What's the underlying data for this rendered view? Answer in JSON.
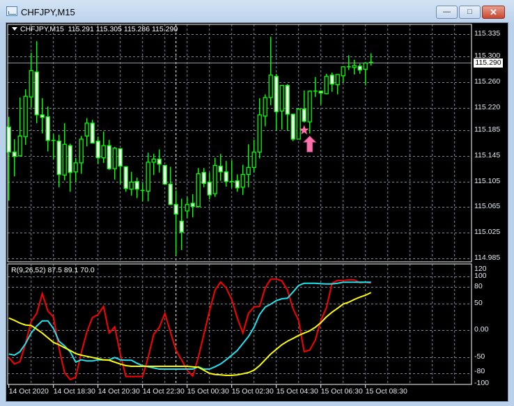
{
  "window": {
    "title": "CHFJPY,M15",
    "buttons": {
      "minimize": "—",
      "maximize": "□",
      "close": "✕"
    }
  },
  "chart_header": {
    "symbol": "CHFJPY,M15",
    "open": "115.291",
    "high": "115.305",
    "low": "115.286",
    "close": "115.290"
  },
  "current_price": "115.290",
  "colors": {
    "background": "#000000",
    "candle": "#00ff00",
    "bear_body": "#ffffff",
    "grid": "#7b8595",
    "red_line": "#ff0000",
    "cyan_line": "#22e4f0",
    "yellow_line": "#ffff00",
    "marker": "#ff6fa8"
  },
  "indicator": {
    "label": "R(9,26,52) 87.5 89.1 70.0"
  },
  "chart_data": [
    {
      "type": "candlestick",
      "title": "CHFJPY,M15",
      "ylim": [
        114.985,
        115.345
      ],
      "y_ticks": [
        "115.335",
        "115.300",
        "115.260",
        "115.220",
        "115.185",
        "115.145",
        "115.105",
        "115.065",
        "115.025",
        "114.985"
      ],
      "x_ticks": [
        "14 Oct 2020",
        "14 Oct 18:30",
        "14 Oct 20:30",
        "14 Oct 22:30",
        "15 Oct 00:30",
        "15 Oct 02:30",
        "15 Oct 04:30",
        "15 Oct 06:30",
        "15 Oct 08:30"
      ],
      "x_tick_every": 8,
      "day_separator_index": 30,
      "ohlc": [
        [
          115.19,
          115.206,
          115.075,
          115.151
        ],
        [
          115.151,
          115.171,
          115.113,
          115.144
        ],
        [
          115.145,
          115.236,
          115.144,
          115.176
        ],
        [
          115.175,
          115.249,
          115.162,
          115.238
        ],
        [
          115.237,
          115.306,
          115.22,
          115.278
        ],
        [
          115.276,
          115.324,
          115.196,
          115.209
        ],
        [
          115.209,
          115.235,
          115.18,
          115.205
        ],
        [
          115.206,
          115.222,
          115.152,
          115.169
        ],
        [
          115.169,
          115.179,
          115.14,
          115.169
        ],
        [
          115.168,
          115.178,
          115.096,
          115.116
        ],
        [
          115.115,
          115.196,
          115.107,
          115.163
        ],
        [
          115.161,
          115.164,
          115.089,
          115.119
        ],
        [
          115.12,
          115.142,
          115.104,
          115.134
        ],
        [
          115.134,
          115.176,
          115.117,
          115.171
        ],
        [
          115.176,
          115.204,
          115.16,
          115.196
        ],
        [
          115.196,
          115.201,
          115.164,
          115.165
        ],
        [
          115.168,
          115.175,
          115.132,
          115.142
        ],
        [
          115.142,
          115.183,
          115.134,
          115.161
        ],
        [
          115.161,
          115.17,
          115.123,
          115.125
        ],
        [
          115.125,
          115.159,
          115.108,
          115.157
        ],
        [
          115.156,
          115.157,
          115.101,
          115.129
        ],
        [
          115.128,
          115.129,
          115.089,
          115.094
        ],
        [
          115.093,
          115.12,
          115.083,
          115.104
        ],
        [
          115.105,
          115.111,
          115.079,
          115.093
        ],
        [
          115.091,
          115.103,
          115.074,
          115.091
        ],
        [
          115.09,
          115.15,
          115.074,
          115.135
        ],
        [
          115.135,
          115.148,
          115.115,
          115.14
        ],
        [
          115.14,
          115.155,
          115.119,
          115.132
        ],
        [
          115.13,
          115.13,
          115.101,
          115.101
        ],
        [
          115.101,
          115.128,
          115.068,
          115.069
        ],
        [
          115.069,
          115.091,
          114.99,
          115.054
        ],
        [
          115.043,
          115.078,
          114.998,
          115.026
        ],
        [
          115.059,
          115.081,
          115.048,
          115.069
        ],
        [
          115.071,
          115.085,
          115.049,
          115.066
        ],
        [
          115.066,
          115.126,
          115.064,
          115.117
        ],
        [
          115.119,
          115.126,
          115.096,
          115.102
        ],
        [
          115.104,
          115.119,
          115.077,
          115.084
        ],
        [
          115.086,
          115.142,
          115.081,
          115.13
        ],
        [
          115.129,
          115.148,
          115.106,
          115.12
        ],
        [
          115.12,
          115.137,
          115.097,
          115.105
        ],
        [
          115.105,
          115.138,
          115.095,
          115.105
        ],
        [
          115.106,
          115.116,
          115.089,
          115.095
        ],
        [
          115.096,
          115.131,
          115.084,
          115.116
        ],
        [
          115.116,
          115.163,
          115.096,
          115.127
        ],
        [
          115.127,
          115.17,
          115.119,
          115.151
        ],
        [
          115.151,
          115.235,
          115.141,
          115.209
        ],
        [
          115.207,
          115.241,
          115.191,
          115.236
        ],
        [
          115.236,
          115.331,
          115.224,
          115.271
        ],
        [
          115.269,
          115.273,
          115.184,
          115.214
        ],
        [
          115.215,
          115.255,
          115.186,
          115.255
        ],
        [
          115.255,
          115.257,
          115.184,
          115.21
        ],
        [
          115.21,
          115.21,
          115.168,
          115.171
        ],
        [
          115.171,
          115.22,
          115.171,
          115.218
        ],
        [
          115.218,
          115.247,
          115.197,
          115.199
        ],
        [
          115.198,
          115.247,
          115.18,
          115.246
        ],
        [
          115.246,
          115.268,
          115.237,
          115.246
        ],
        [
          115.246,
          115.247,
          115.225,
          115.243
        ],
        [
          115.242,
          115.273,
          115.241,
          115.269
        ],
        [
          115.271,
          115.275,
          115.245,
          115.257
        ],
        [
          115.256,
          115.272,
          115.241,
          115.272
        ],
        [
          115.27,
          115.285,
          115.26,
          115.284
        ],
        [
          115.284,
          115.302,
          115.279,
          115.284
        ],
        [
          115.283,
          115.295,
          115.272,
          115.286
        ],
        [
          115.285,
          115.289,
          115.273,
          115.279
        ],
        [
          115.28,
          115.291,
          115.255,
          115.29
        ],
        [
          115.291,
          115.305,
          115.286,
          115.29
        ]
      ],
      "markers": [
        {
          "type": "star",
          "index": 53,
          "price": 115.185
        },
        {
          "type": "arrow-up",
          "index": 54,
          "price": 115.176
        }
      ]
    },
    {
      "type": "line",
      "title": "R(9,26,52)",
      "ylim": [
        -104,
        125
      ],
      "y_ticks": [
        "120",
        "100",
        "80",
        "50",
        "0.00",
        "-50",
        "-80",
        "-100"
      ],
      "y_tick_values": [
        120,
        100,
        80,
        50,
        0,
        -50,
        -80,
        -100
      ],
      "grid_values": [
        100,
        80,
        50,
        0,
        -50,
        -80
      ],
      "series": [
        {
          "name": "red",
          "color": "#ff0000",
          "values": [
            -50.3,
            -62.4,
            -58.1,
            -24.5,
            16.3,
            31.4,
            67.9,
            35.6,
            24.9,
            -33.2,
            -78.3,
            -91.2,
            -86.9,
            -41.8,
            -3.1,
            23.6,
            29.2,
            44.3,
            -5.2,
            6.5,
            -43.9,
            -85.6,
            -85.6,
            -85.6,
            -85.6,
            -50.3,
            -7.4,
            5.5,
            31.4,
            -3.1,
            -37.4,
            -54.7,
            -74.0,
            -84.8,
            -50.3,
            -7.4,
            35.6,
            74.3,
            89.4,
            78.7,
            57.2,
            22.7,
            -5.2,
            31.4,
            43.4,
            44.3,
            78.7,
            95.0,
            95.0,
            91.6,
            74.3,
            40.0,
            18.5,
            -39.6,
            -36.6,
            -18.1,
            18.5,
            42.1,
            87.2,
            92.4,
            92.4,
            93.3,
            93.3,
            88.1,
            89.0,
            87.5
          ]
        },
        {
          "name": "cyan",
          "color": "#22e4f0",
          "values": [
            -43.9,
            -46.1,
            -39.6,
            -24.5,
            -5.2,
            7.7,
            17.5,
            17.5,
            3.4,
            -20.3,
            -28.9,
            -39.6,
            -59.0,
            -54.7,
            -56.8,
            -56.8,
            -54.7,
            -54.7,
            -54.7,
            -50.3,
            -54.7,
            -55.5,
            -55.5,
            -61.1,
            -65.4,
            -67.6,
            -69.7,
            -71.9,
            -71.9,
            -71.9,
            -71.9,
            -71.9,
            -71.9,
            -71.9,
            -67.6,
            -71.9,
            -71.9,
            -67.6,
            -62.4,
            -54.7,
            -46.1,
            -37.4,
            -24.5,
            -11.6,
            5.5,
            29.2,
            43.0,
            48.5,
            55.0,
            58.5,
            59.4,
            71.0,
            83.0,
            87.2,
            87.2,
            87.2,
            86.3,
            85.9,
            85.9,
            87.2,
            89.0,
            89.0,
            89.0,
            89.0,
            89.1,
            89.1
          ]
        },
        {
          "name": "yellow",
          "color": "#ffff00",
          "values": [
            22.7,
            18.5,
            13.3,
            9.8,
            9.0,
            2.1,
            -5.2,
            -13.8,
            -22.5,
            -26.7,
            -32.3,
            -37.4,
            -43.1,
            -46.1,
            -48.3,
            -50.3,
            -52.5,
            -54.7,
            -55.5,
            -59.0,
            -62.4,
            -65.4,
            -66.7,
            -66.7,
            -66.7,
            -66.7,
            -66.7,
            -66.7,
            -66.7,
            -66.7,
            -66.7,
            -66.7,
            -66.7,
            -67.6,
            -68.4,
            -74.0,
            -79.6,
            -81.8,
            -82.6,
            -83.5,
            -83.5,
            -82.6,
            -80.5,
            -78.3,
            -74.0,
            -65.4,
            -54.7,
            -43.9,
            -35.4,
            -26.7,
            -20.3,
            -15.1,
            -9.5,
            -5.2,
            -0.9,
            5.5,
            14.2,
            24.9,
            33.5,
            40.8,
            48.5,
            52.0,
            57.2,
            61.4,
            64.9,
            70.0
          ]
        }
      ]
    }
  ]
}
